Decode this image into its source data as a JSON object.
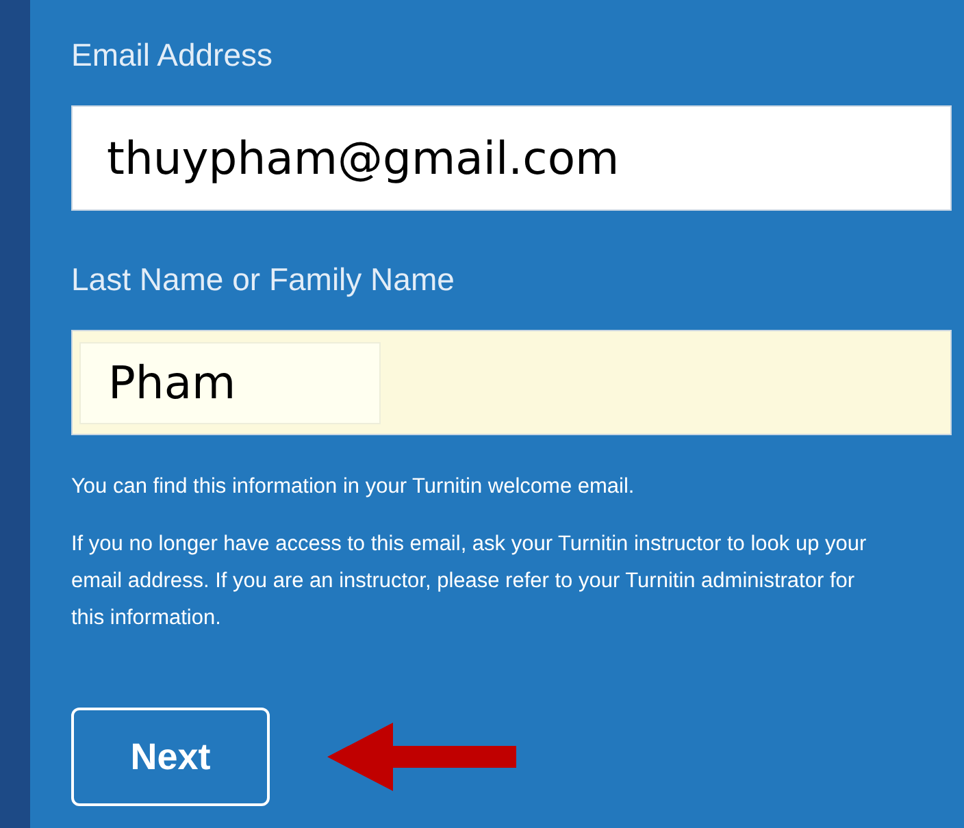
{
  "fields": [
    {
      "label": "Email Address",
      "value": "thuypham@gmail.com",
      "autofilled": false
    },
    {
      "label": "Last Name or Family Name",
      "value": "Pham",
      "autofilled": true
    }
  ],
  "hint": "You can find this information in your Turnitin welcome email.",
  "help": "If you no longer have access to this email, ask your Turnitin instructor to look up your email address. If you are an instructor, please refer to your Turnitin administrator for this information.",
  "button": "Next"
}
